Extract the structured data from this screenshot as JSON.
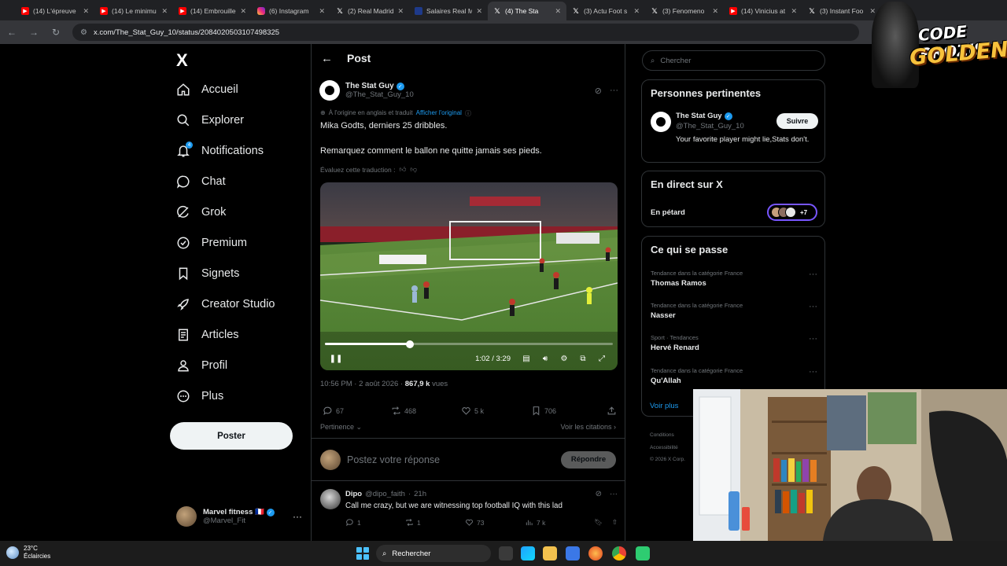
{
  "browser": {
    "tabs": [
      {
        "icon": "youtube-icon",
        "title": "(14) L'épreuve"
      },
      {
        "icon": "youtube-icon",
        "title": "(14) Le minimu"
      },
      {
        "icon": "youtube-icon",
        "title": "(14) Embrouille"
      },
      {
        "icon": "instagram-icon",
        "title": "(6) Instagram"
      },
      {
        "icon": "x-icon",
        "title": "(2) Real Madrid"
      },
      {
        "icon": "salaires-icon",
        "title": "Salaires Real M"
      },
      {
        "icon": "x-icon",
        "title": "(4) The Sta",
        "active": true
      },
      {
        "icon": "x-icon",
        "title": "(3) Actu Foot s"
      },
      {
        "icon": "x-icon",
        "title": "(3) Fenomeno"
      },
      {
        "icon": "youtube-icon",
        "title": "(14) Vinicius at"
      },
      {
        "icon": "x-icon",
        "title": "(3) Instant Foo"
      }
    ],
    "url": "x.com/The_Stat_Guy_10/status/2084020503107498325"
  },
  "sidebar": {
    "logo": "X",
    "items": [
      {
        "label": "Accueil",
        "icon": "home-icon"
      },
      {
        "label": "Explorer",
        "icon": "search-icon"
      },
      {
        "label": "Notifications",
        "icon": "bell-icon",
        "badge": "4"
      },
      {
        "label": "Chat",
        "icon": "chat-icon"
      },
      {
        "label": "Grok",
        "icon": "grok-icon"
      },
      {
        "label": "Premium",
        "icon": "premium-icon"
      },
      {
        "label": "Signets",
        "icon": "bookmark-icon"
      },
      {
        "label": "Creator Studio",
        "icon": "rocket-icon"
      },
      {
        "label": "Articles",
        "icon": "article-icon"
      },
      {
        "label": "Profil",
        "icon": "person-icon"
      },
      {
        "label": "Plus",
        "icon": "more-icon"
      }
    ],
    "post_button": "Poster",
    "account": {
      "name": "Marvel fitness",
      "flag": "🇫🇷",
      "handle": "@Marvel_Fit"
    }
  },
  "post": {
    "header_title": "Post",
    "author_name": "The Stat Guy",
    "author_handle": "@The_Stat_Guy_10",
    "translate_note": "À l'origine en anglais et traduit",
    "translate_link": "Afficher l'original",
    "text_line1": "Mika Godts, derniers 25 dribbles.",
    "text_line2": "Remarquez comment le ballon ne quitte jamais ses pieds.",
    "rate_translation": "Évaluez cette traduction :",
    "video": {
      "current_time": "1:02",
      "duration": "3:29",
      "progress": 0.296
    },
    "time": "10:56 PM",
    "date": "2 août 2026",
    "views_count": "867,9 k",
    "views_label": "vues",
    "replies": "67",
    "reposts": "468",
    "likes": "5 k",
    "bookmarks": "706",
    "sort_label": "Pertinence",
    "quotes_link": "Voir les citations",
    "reply_placeholder": "Postez votre réponse",
    "reply_button": "Répondre"
  },
  "comment": {
    "name": "Dipo",
    "handle": "@dipo_faith",
    "age": "21h",
    "text": "Call me crazy, but we are witnessing top football IQ with this lad",
    "replies": "1",
    "reposts": "1",
    "likes": "73",
    "views": "7 k"
  },
  "right": {
    "search_placeholder": "Chercher",
    "relevant_title": "Personnes pertinentes",
    "person": {
      "name": "The Stat Guy",
      "handle": "@The_Stat_Guy_10",
      "bio": "Your favorite player might lie,Stats don't.",
      "follow": "Suivre"
    },
    "live_title": "En direct sur X",
    "live_item": "En pétard",
    "live_more": "+7",
    "trends_title": "Ce qui se passe",
    "trends": [
      {
        "category": "Tendance dans la catégorie France",
        "name": "Thomas Ramos"
      },
      {
        "category": "Tendance dans la catégorie France",
        "name": "Nasser"
      },
      {
        "category": "Sport · Tendances",
        "name": "Hervé Renard"
      },
      {
        "category": "Tendance dans la catégorie France",
        "name": "Qu'Allah"
      }
    ],
    "see_more": "Voir plus",
    "footer": [
      "Conditions",
      "Accessibilité",
      "© 2026 X Corp."
    ]
  },
  "overlay": {
    "logo_line1": "CODE PROZIS",
    "logo_line2": "GOLDENG"
  },
  "taskbar": {
    "temp": "23°C",
    "weather": "Éclaircies",
    "search": "Rechercher"
  },
  "colors": {
    "accent": "#1d9bf0",
    "background": "#000000",
    "border": "#2f3336",
    "muted": "#71767b"
  }
}
